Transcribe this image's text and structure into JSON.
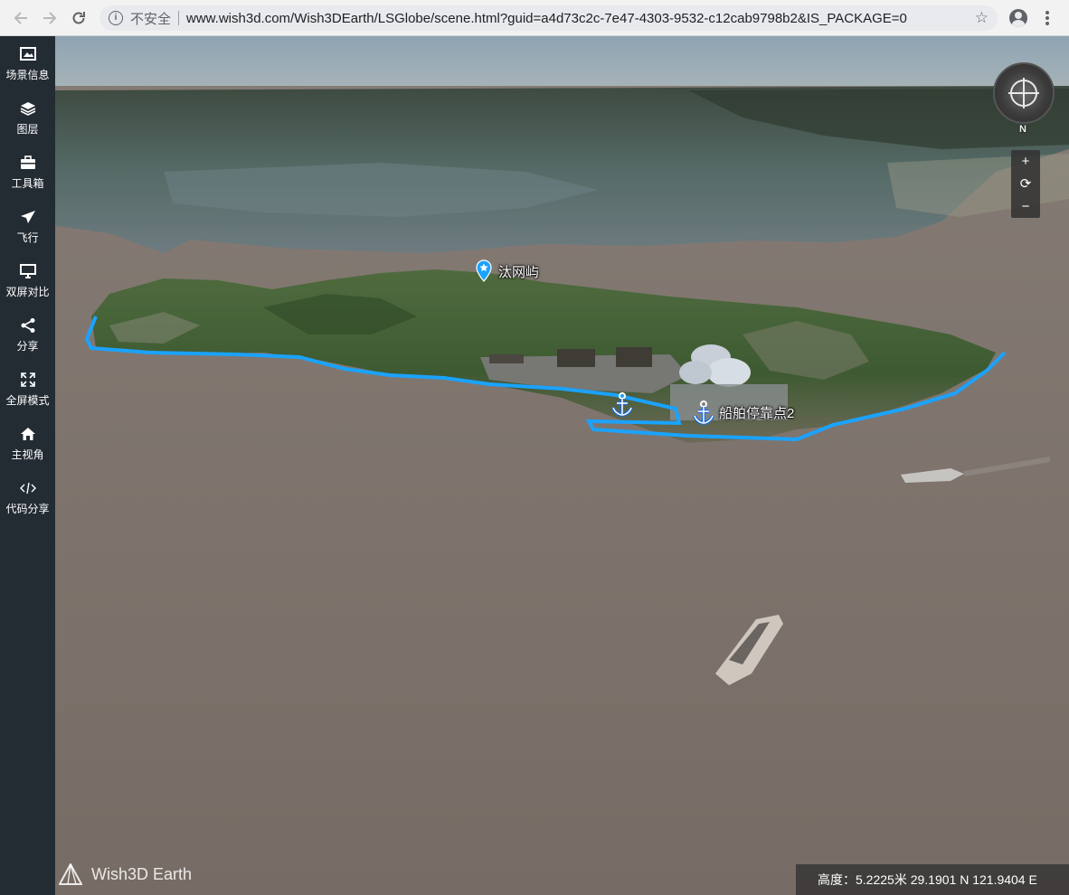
{
  "browser": {
    "security_label": "不安全",
    "url": "www.wish3d.com/Wish3DEarth/LSGlobe/scene.html?guid=a4d73c2c-7e47-4303-9532-c12cab9798b2&IS_PACKAGE=0",
    "icons": [
      "back-arrow-icon",
      "forward-arrow-icon",
      "reload-icon",
      "info-icon",
      "star-icon",
      "account-icon",
      "menu-icon"
    ]
  },
  "sidebar": {
    "items": [
      {
        "label": "场景信息",
        "icon": "scene-info-icon"
      },
      {
        "label": "图层",
        "icon": "layers-icon"
      },
      {
        "label": "工具箱",
        "icon": "toolbox-icon"
      },
      {
        "label": "飞行",
        "icon": "fly-icon"
      },
      {
        "label": "双屏对比",
        "icon": "split-screen-icon"
      },
      {
        "label": "分享",
        "icon": "share-icon"
      },
      {
        "label": "全屏模式",
        "icon": "fullscreen-icon"
      },
      {
        "label": "主视角",
        "icon": "home-icon"
      },
      {
        "label": "代码分享",
        "icon": "code-icon"
      }
    ]
  },
  "map": {
    "markers": [
      {
        "label": "汰网屿",
        "icon": "location-pin-icon"
      },
      {
        "label": "船舶停靠点2",
        "icon": "anchor-icon"
      }
    ],
    "compass_label": "N",
    "zoom": {
      "in": "+",
      "reset": "⟳",
      "out": "−"
    },
    "logo_text": "Wish3D Earth"
  },
  "status": {
    "text": "高度：5.2225米 29.1901 N 121.9404 E"
  },
  "colors": {
    "sidebar_bg": "#232b33",
    "route_blue": "#1aa3ff",
    "water": "#7b7068"
  }
}
